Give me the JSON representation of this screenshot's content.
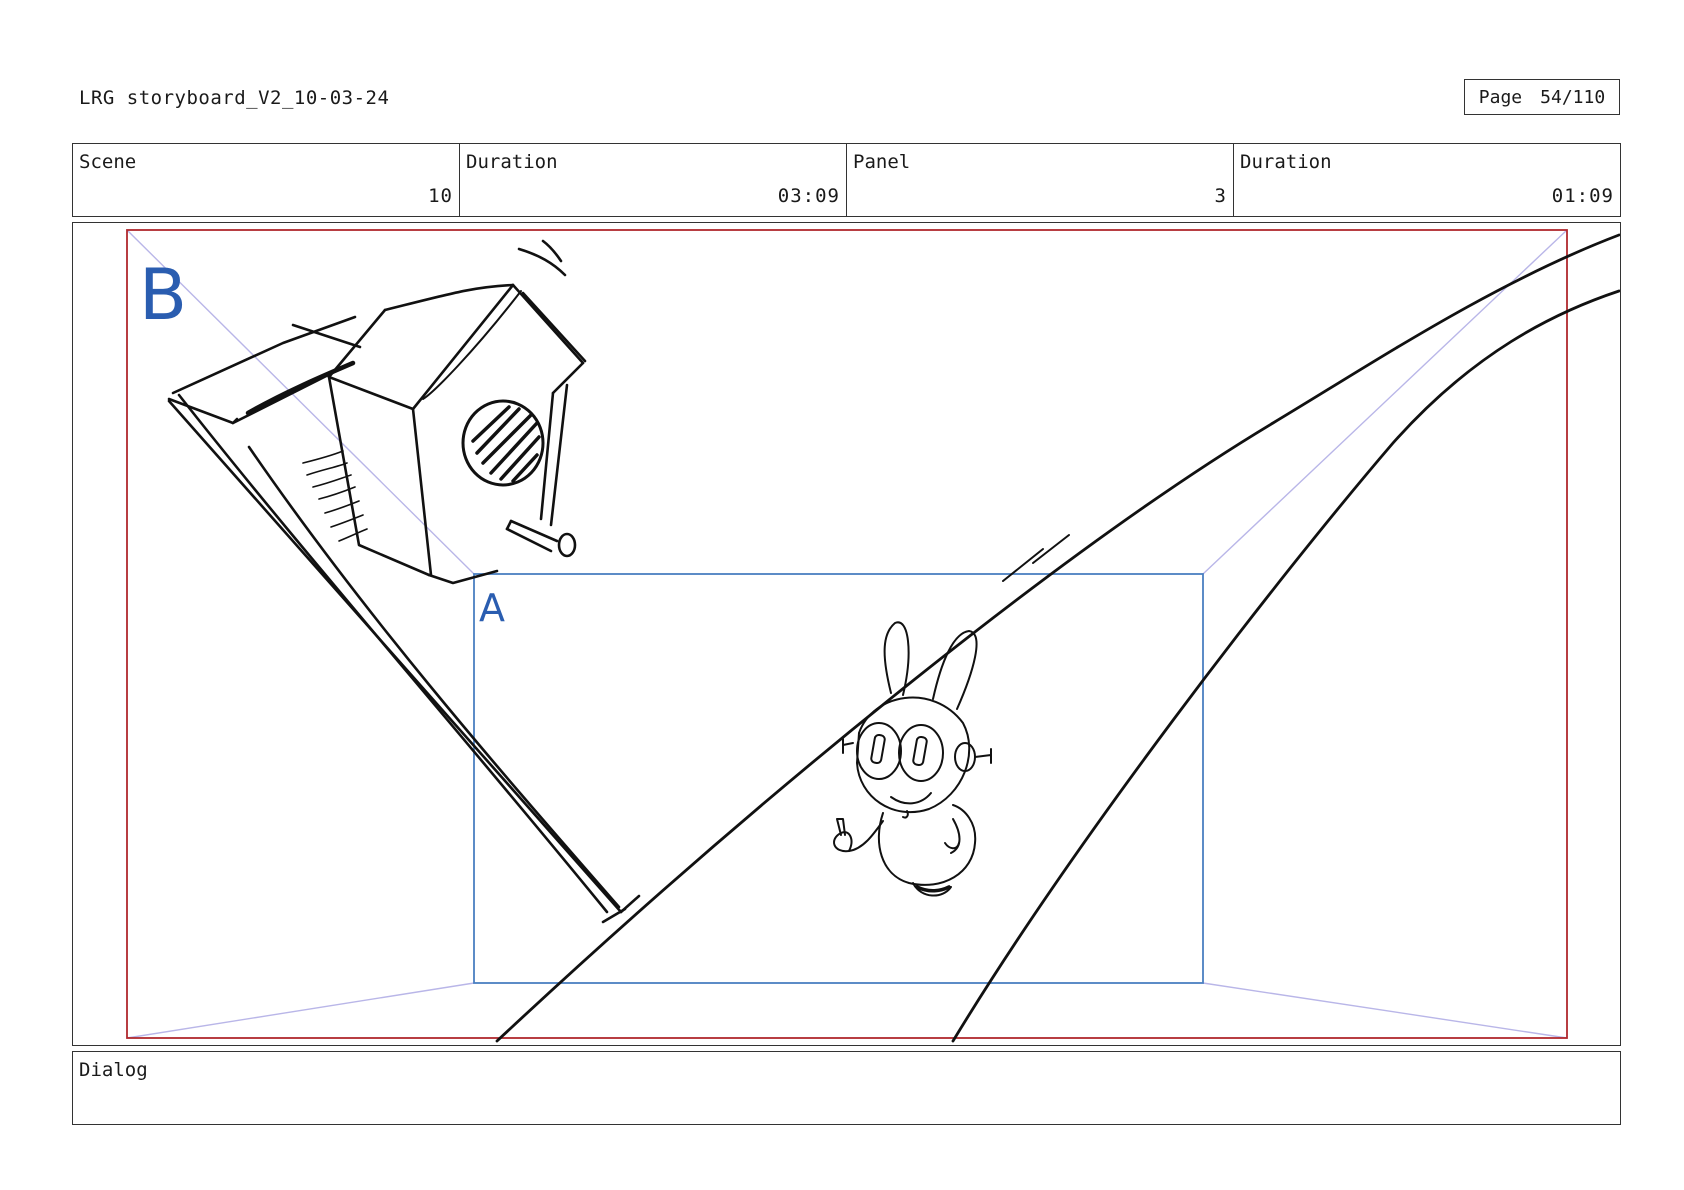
{
  "header": {
    "title": "LRG storyboard_V2_10-03-24",
    "page_label": "Page",
    "page_value": "54/110"
  },
  "info": {
    "scene_label": "Scene",
    "scene_value": "10",
    "scene_duration_label": "Duration",
    "scene_duration_value": "03:09",
    "panel_label": "Panel",
    "panel_value": "3",
    "panel_duration_label": "Duration",
    "panel_duration_value": "01:09"
  },
  "panel": {
    "camera_b_label": "B",
    "camera_a_label": "A",
    "colors": {
      "frame_b": "#b0282e",
      "frame_a": "#4a7fc1",
      "label": "#2a5db0",
      "guides": "#b9b6e8",
      "ink": "#111111"
    }
  },
  "dialog": {
    "label": "Dialog",
    "text": ""
  }
}
